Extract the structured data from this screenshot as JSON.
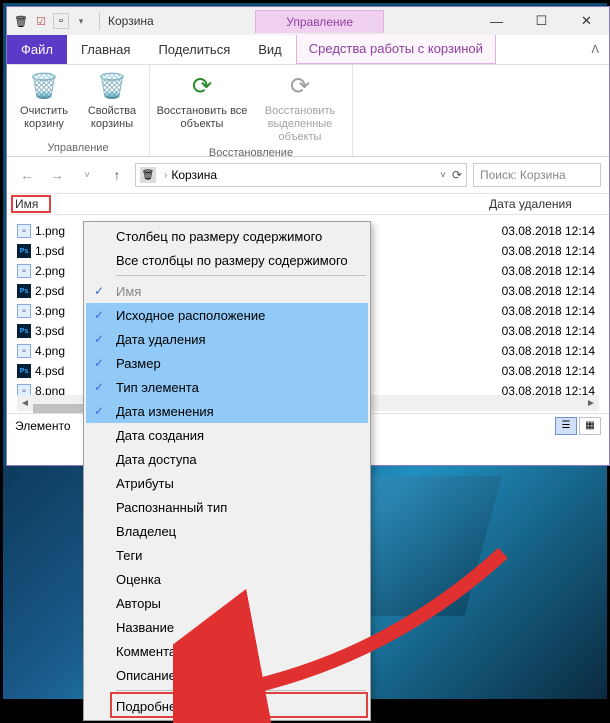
{
  "window": {
    "title": "Корзина",
    "manage_label": "Управление"
  },
  "menu": {
    "file": "Файл",
    "home": "Главная",
    "share": "Поделиться",
    "view": "Вид",
    "context_tab": "Средства работы с корзиной"
  },
  "ribbon": {
    "empty_bin": "Очистить корзину",
    "bin_props": "Свойства корзины",
    "restore_all": "Восстановить все объекты",
    "restore_selected": "Восстановить выделенные объекты",
    "group_manage": "Управление",
    "group_restore": "Восстановление"
  },
  "address": {
    "location": "Корзина",
    "search_placeholder": "Поиск: Корзина"
  },
  "columns": {
    "name": "Имя",
    "date_deleted": "Дата удаления"
  },
  "files": [
    {
      "name": "1.png",
      "type": "png"
    },
    {
      "name": "1.psd",
      "type": "psd"
    },
    {
      "name": "2.png",
      "type": "png"
    },
    {
      "name": "2.psd",
      "type": "psd"
    },
    {
      "name": "3.png",
      "type": "png"
    },
    {
      "name": "3.psd",
      "type": "psd"
    },
    {
      "name": "4.png",
      "type": "png"
    },
    {
      "name": "4.psd",
      "type": "psd"
    },
    {
      "name": "8.png",
      "type": "png"
    }
  ],
  "dates": [
    "03.08.2018 12:14",
    "03.08.2018 12:14",
    "03.08.2018 12:14",
    "03.08.2018 12:14",
    "03.08.2018 12:14",
    "03.08.2018 12:14",
    "03.08.2018 12:14",
    "03.08.2018 12:14",
    "03.08.2018 12:14"
  ],
  "statusbar": {
    "items_label": "Элементо"
  },
  "context_menu": {
    "size_column": "Столбец по размеру содержимого",
    "size_all": "Все столбцы по размеру содержимого",
    "col_name": "Имя",
    "col_original": "Исходное расположение",
    "col_date_deleted": "Дата удаления",
    "col_size": "Размер",
    "col_type": "Тип элемента",
    "col_date_modified": "Дата изменения",
    "col_date_created": "Дата создания",
    "col_date_accessed": "Дата доступа",
    "col_attributes": "Атрибуты",
    "col_perceived": "Распознанный тип",
    "col_owner": "Владелец",
    "col_tags": "Теги",
    "col_rating": "Оценка",
    "col_authors": "Авторы",
    "col_title": "Название",
    "col_comments": "Комментарии",
    "col_filedesc": "Описание файла",
    "more": "Подробнее..."
  }
}
